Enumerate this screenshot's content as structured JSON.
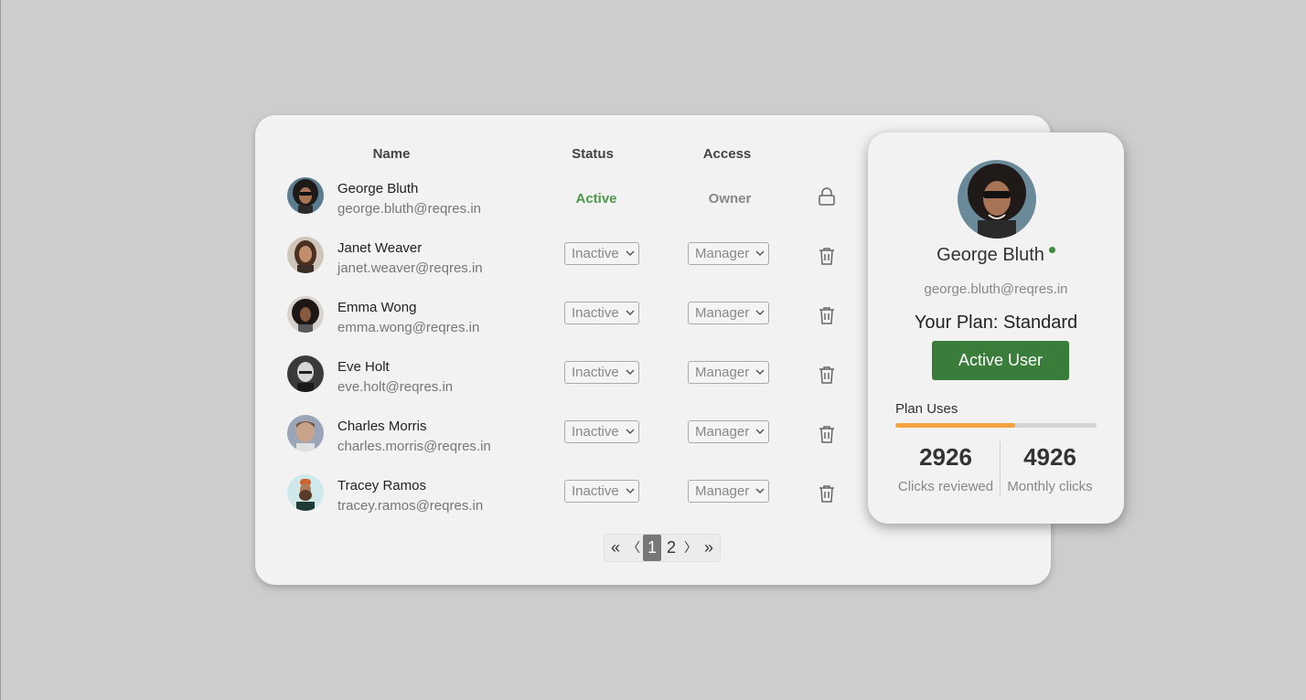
{
  "table": {
    "headers": {
      "name": "Name",
      "status": "Status",
      "access": "Access"
    },
    "rows": [
      {
        "name": "George Bluth",
        "email": "george.bluth@reqres.in",
        "status": "Active",
        "access": "Owner",
        "action_icon": "lock-icon",
        "editable": false
      },
      {
        "name": "Janet Weaver",
        "email": "janet.weaver@reqres.in",
        "status": "Inactive",
        "access": "Manager",
        "action_icon": "trash-icon",
        "editable": true
      },
      {
        "name": "Emma Wong",
        "email": "emma.wong@reqres.in",
        "status": "Inactive",
        "access": "Manager",
        "action_icon": "trash-icon",
        "editable": true
      },
      {
        "name": "Eve Holt",
        "email": "eve.holt@reqres.in",
        "status": "Inactive",
        "access": "Manager",
        "action_icon": "trash-icon",
        "editable": true
      },
      {
        "name": "Charles Morris",
        "email": "charles.morris@reqres.in",
        "status": "Inactive",
        "access": "Manager",
        "action_icon": "trash-icon",
        "editable": true
      },
      {
        "name": "Tracey Ramos",
        "email": "tracey.ramos@reqres.in",
        "status": "Inactive",
        "access": "Manager",
        "action_icon": "trash-icon",
        "editable": true
      }
    ]
  },
  "pagination": {
    "first": "«",
    "prev": "〈",
    "pages": [
      "1",
      "2"
    ],
    "current_page": "1",
    "next": "〉",
    "last": "»"
  },
  "profile": {
    "name": "George Bluth",
    "email": "george.bluth@reqres.in",
    "plan": "Your Plan: Standard",
    "button_label": "Active User",
    "plan_uses_label": "Plan Uses",
    "usage_fraction": 0.595,
    "stats": [
      {
        "value": "2926",
        "label": "Clicks reviewed"
      },
      {
        "value": "4926",
        "label": "Monthly clicks"
      }
    ]
  },
  "colors": {
    "active_status": "#4a9a4a",
    "button_green": "#3a7d3a",
    "usage_orange": "#f5a340",
    "online_dot": "#3a8f3a"
  }
}
